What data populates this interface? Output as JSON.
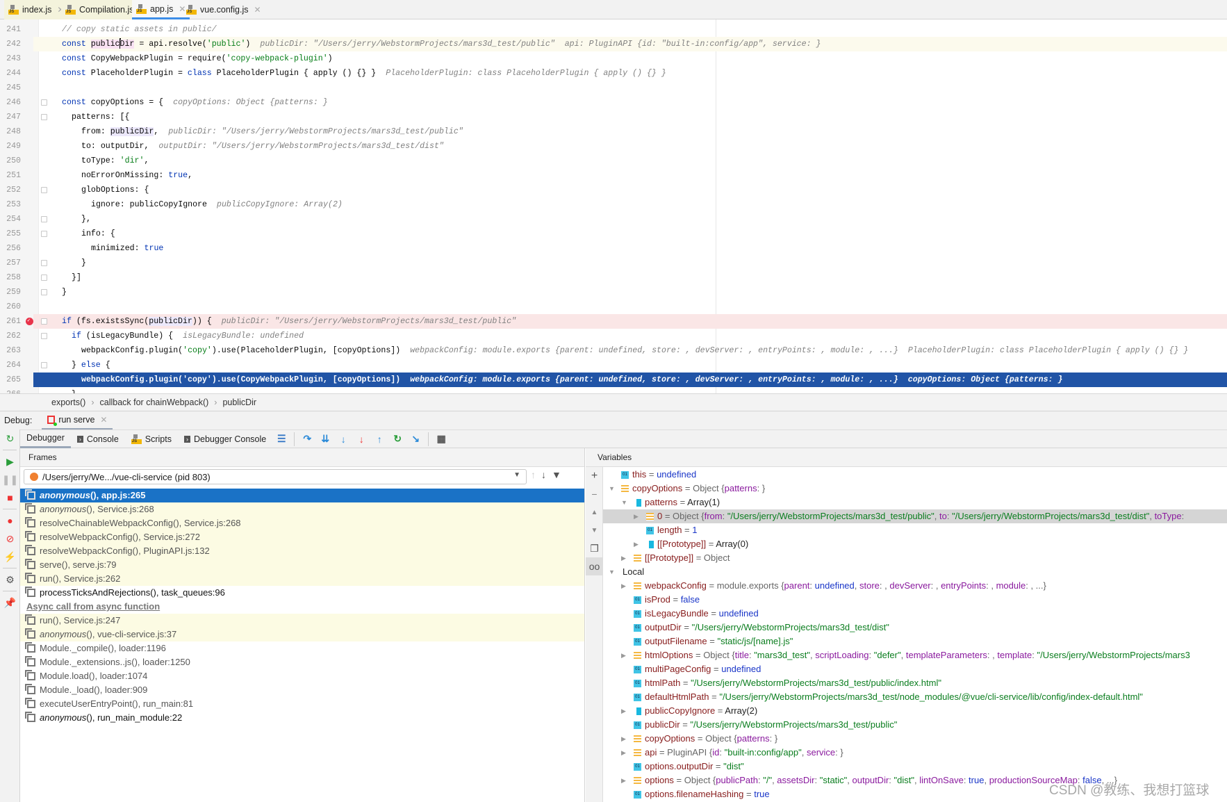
{
  "tabs": [
    {
      "label": "index.js",
      "style": "yellow"
    },
    {
      "label": "Compilation.js",
      "style": "yellow"
    },
    {
      "label": "app.js",
      "style": "sel"
    },
    {
      "label": "vue.config.js",
      "style": ""
    }
  ],
  "editor": {
    "lines": [
      {
        "n": "241",
        "indent": 0,
        "tokens": [
          [
            "// copy static assets in public/",
            "cm"
          ]
        ]
      },
      {
        "n": "242",
        "indent": 0,
        "state": "cur",
        "tokens": [
          [
            "const ",
            "kw"
          ],
          [
            "public",
            "pl hlp"
          ],
          [
            "|caret",
            ""
          ],
          [
            "Dir",
            "pl hlp"
          ],
          [
            " = api.resolve(",
            "pl"
          ],
          [
            "'public'",
            "str"
          ],
          [
            ")",
            "pl"
          ]
        ],
        "hint": "publicDir: \"/Users/jerry/WebstormProjects/mars3d_test/public\"  api: PluginAPI {id: \"built-in:config/app\", service: }"
      },
      {
        "n": "243",
        "indent": 0,
        "tokens": [
          [
            "const ",
            "kw"
          ],
          [
            "CopyWebpackPlugin = require(",
            "pl"
          ],
          [
            "'copy-webpack-plugin'",
            "str"
          ],
          [
            ")",
            "pl"
          ]
        ]
      },
      {
        "n": "244",
        "indent": 0,
        "tokens": [
          [
            "const ",
            "kw"
          ],
          [
            "PlaceholderPlugin = ",
            "pl"
          ],
          [
            "class ",
            "kw"
          ],
          [
            "PlaceholderPlugin { apply () {} }",
            "pl"
          ]
        ],
        "hint": "PlaceholderPlugin: class PlaceholderPlugin { apply () {} }"
      },
      {
        "n": "245",
        "indent": 0,
        "tokens": []
      },
      {
        "n": "246",
        "indent": 0,
        "fold": true,
        "tokens": [
          [
            "const ",
            "kw"
          ],
          [
            "copyOptions = {",
            "pl"
          ]
        ],
        "hint": "copyOptions: Object {patterns: }"
      },
      {
        "n": "247",
        "indent": 1,
        "fold": true,
        "tokens": [
          [
            "patterns: [{",
            "pl"
          ]
        ]
      },
      {
        "n": "248",
        "indent": 2,
        "tokens": [
          [
            "from: ",
            "pl"
          ],
          [
            "publicDir",
            "pl hlv"
          ],
          [
            ",",
            "pl"
          ]
        ],
        "hint": "publicDir: \"/Users/jerry/WebstormProjects/mars3d_test/public\""
      },
      {
        "n": "249",
        "indent": 2,
        "tokens": [
          [
            "to: outputDir,",
            "pl"
          ]
        ],
        "hint": "outputDir: \"/Users/jerry/WebstormProjects/mars3d_test/dist\""
      },
      {
        "n": "250",
        "indent": 2,
        "tokens": [
          [
            "toType: ",
            "pl"
          ],
          [
            "'dir'",
            "str"
          ],
          [
            ",",
            "pl"
          ]
        ]
      },
      {
        "n": "251",
        "indent": 2,
        "tokens": [
          [
            "noErrorOnMissing: ",
            "pl"
          ],
          [
            "true",
            "kw"
          ],
          [
            ",",
            "pl"
          ]
        ]
      },
      {
        "n": "252",
        "indent": 2,
        "fold": true,
        "tokens": [
          [
            "globOptions: {",
            "pl"
          ]
        ]
      },
      {
        "n": "253",
        "indent": 3,
        "tokens": [
          [
            "ignore: publicCopyIgnore",
            "pl"
          ]
        ],
        "hint": "publicCopyIgnore: Array(2)"
      },
      {
        "n": "254",
        "indent": 2,
        "fold": true,
        "tokens": [
          [
            "},",
            "pl"
          ]
        ]
      },
      {
        "n": "255",
        "indent": 2,
        "fold": true,
        "tokens": [
          [
            "info: {",
            "pl"
          ]
        ]
      },
      {
        "n": "256",
        "indent": 3,
        "tokens": [
          [
            "minimized: ",
            "pl"
          ],
          [
            "true",
            "kw"
          ]
        ]
      },
      {
        "n": "257",
        "indent": 2,
        "fold": true,
        "tokens": [
          [
            "}",
            "pl"
          ]
        ]
      },
      {
        "n": "258",
        "indent": 1,
        "fold": true,
        "tokens": [
          [
            "}]",
            "pl"
          ]
        ]
      },
      {
        "n": "259",
        "indent": 0,
        "fold": true,
        "tokens": [
          [
            "}",
            "pl"
          ]
        ]
      },
      {
        "n": "260",
        "indent": 0,
        "tokens": []
      },
      {
        "n": "261",
        "indent": 0,
        "state": "brk",
        "breakpoint": true,
        "fold": true,
        "tokens": [
          [
            "if ",
            "kw"
          ],
          [
            "(fs.existsSync(",
            "pl"
          ],
          [
            "publicDir",
            "pl hlv"
          ],
          [
            ")) {",
            "pl"
          ]
        ],
        "hint": "publicDir: \"/Users/jerry/WebstormProjects/mars3d_test/public\""
      },
      {
        "n": "262",
        "indent": 1,
        "fold": true,
        "tokens": [
          [
            "if ",
            "kw"
          ],
          [
            "(isLegacyBundle) {",
            "pl"
          ]
        ],
        "hint": "isLegacyBundle: undefined"
      },
      {
        "n": "263",
        "indent": 2,
        "tokens": [
          [
            "webpackConfig.plugin(",
            "pl"
          ],
          [
            "'copy'",
            "str"
          ],
          [
            ").use(PlaceholderPlugin, [copyOptions])",
            "pl"
          ]
        ],
        "hint": "webpackConfig: module.exports {parent: undefined, store: , devServer: , entryPoints: , module: , ...}  PlaceholderPlugin: class PlaceholderPlugin { apply () {} }"
      },
      {
        "n": "264",
        "indent": 1,
        "fold": true,
        "tokens": [
          [
            "} ",
            "pl"
          ],
          [
            "else ",
            "kw"
          ],
          [
            "{",
            "pl"
          ]
        ]
      },
      {
        "n": "265",
        "indent": 2,
        "state": "exec",
        "tokens": [
          [
            "webpackConfig.plugin('copy').use(CopyWebpackPlugin, [copyOptions])",
            "pl"
          ]
        ],
        "hint": "webpackConfig: module.exports {parent: undefined, store: , devServer: , entryPoints: , module: , ...}  copyOptions: Object {patterns: }"
      },
      {
        "n": "266",
        "indent": 1,
        "tokens": [
          [
            "}",
            "pl"
          ]
        ]
      }
    ]
  },
  "breadcrumb": [
    "exports()",
    "callback for chainWebpack()",
    "publicDir"
  ],
  "debug": {
    "label": "Debug:",
    "run_tab": "run serve",
    "tabs": [
      "Debugger",
      "Console",
      "Scripts",
      "Debugger Console"
    ],
    "frames_title": "Frames",
    "variables_title": "Variables",
    "thread": "/Users/jerry/We.../vue-cli-service (pid 803)"
  },
  "frames": [
    {
      "fn": "anonymous",
      "rest": "(), app.js:265",
      "style": "sel",
      "italic": true
    },
    {
      "fn": "anonymous",
      "rest": "(), Service.js:268",
      "style": "lib",
      "italic": true
    },
    {
      "fn": "resolveChainableWebpackConfig",
      "rest": "(), Service.js:268",
      "style": "lib"
    },
    {
      "fn": "resolveWebpackConfig",
      "rest": "(), Service.js:272",
      "style": "lib"
    },
    {
      "fn": "resolveWebpackConfig",
      "rest": "(), PluginAPI.js:132",
      "style": "lib"
    },
    {
      "fn": "serve",
      "rest": "(), serve.js:79",
      "style": "lib"
    },
    {
      "fn": "run",
      "rest": "(), Service.js:262",
      "style": "lib"
    },
    {
      "fn": "processTicksAndRejections",
      "rest": "(), task_queues:96",
      "style": "dark"
    },
    {
      "separator": "Async call from async function"
    },
    {
      "fn": "run",
      "rest": "(), Service.js:247",
      "style": "lib"
    },
    {
      "fn": "anonymous",
      "rest": "(), vue-cli-service.js:37",
      "style": "lib",
      "italic": true
    },
    {
      "fn": "Module._compile",
      "rest": "(), loader:1196",
      "style": ""
    },
    {
      "fn": "Module._extensions..js",
      "rest": "(), loader:1250",
      "style": ""
    },
    {
      "fn": "Module.load",
      "rest": "(), loader:1074",
      "style": ""
    },
    {
      "fn": "Module._load",
      "rest": "(), loader:909",
      "style": ""
    },
    {
      "fn": "executeUserEntryPoint",
      "rest": "(), run_main:81",
      "style": ""
    },
    {
      "fn": "anonymous",
      "rest": "(), run_main_module:22",
      "style": "dark",
      "italic": true
    }
  ],
  "variables": [
    {
      "lvl": 0,
      "arrow": "",
      "icon": "prim",
      "parts": [
        [
          "this",
          "vn"
        ],
        [
          " = ",
          "vg"
        ],
        [
          "undefined",
          "vb"
        ]
      ]
    },
    {
      "lvl": 0,
      "arrow": "down",
      "icon": "obj",
      "parts": [
        [
          "copyOptions",
          "vn"
        ],
        [
          " = Object {",
          "vg"
        ],
        [
          "patterns",
          "vk"
        ],
        [
          ": }",
          "vg"
        ]
      ]
    },
    {
      "lvl": 1,
      "arrow": "down",
      "icon": "arr",
      "parts": [
        [
          "patterns",
          "vn"
        ],
        [
          " = ",
          "vg"
        ],
        [
          "Array(1)",
          "vp"
        ]
      ]
    },
    {
      "lvl": 2,
      "arrow": "right",
      "icon": "obj",
      "sel": true,
      "parts": [
        [
          "0",
          "vn"
        ],
        [
          " = Object {",
          "vg"
        ],
        [
          "from",
          "vk"
        ],
        [
          ": ",
          "vg"
        ],
        [
          "\"/Users/jerry/WebstormProjects/mars3d_test/public\"",
          "vs"
        ],
        [
          ", ",
          "vg"
        ],
        [
          "to",
          "vk"
        ],
        [
          ": ",
          "vg"
        ],
        [
          "\"/Users/jerry/WebstormProjects/mars3d_test/dist\"",
          "vs"
        ],
        [
          ", ",
          "vg"
        ],
        [
          "toType",
          "vk"
        ],
        [
          ":",
          "vg"
        ]
      ]
    },
    {
      "lvl": 2,
      "arrow": "",
      "icon": "prim",
      "parts": [
        [
          "length",
          "vn"
        ],
        [
          " = ",
          "vg"
        ],
        [
          "1",
          "vb"
        ]
      ]
    },
    {
      "lvl": 2,
      "arrow": "right",
      "icon": "arr",
      "parts": [
        [
          "[[Prototype]]",
          "vn"
        ],
        [
          " = ",
          "vg"
        ],
        [
          "Array(0)",
          "vp"
        ]
      ]
    },
    {
      "lvl": 1,
      "arrow": "right",
      "icon": "obj",
      "parts": [
        [
          "[[Prototype]]",
          "vn"
        ],
        [
          " = Object",
          "vg"
        ]
      ]
    },
    {
      "lvl": 0,
      "arrow": "down",
      "icon": "",
      "parts": [
        [
          "Local",
          "vp"
        ]
      ]
    },
    {
      "lvl": 1,
      "arrow": "right",
      "icon": "obj",
      "parts": [
        [
          "webpackConfig",
          "vn"
        ],
        [
          " = module.exports {",
          "vg"
        ],
        [
          "parent",
          "vk"
        ],
        [
          ": ",
          "vg"
        ],
        [
          "undefined",
          "vb"
        ],
        [
          ", ",
          "vg"
        ],
        [
          "store",
          "vk"
        ],
        [
          ": , ",
          "vg"
        ],
        [
          "devServer",
          "vk"
        ],
        [
          ": , ",
          "vg"
        ],
        [
          "entryPoints",
          "vk"
        ],
        [
          ": , ",
          "vg"
        ],
        [
          "module",
          "vk"
        ],
        [
          ": , ...}",
          "vg"
        ]
      ]
    },
    {
      "lvl": 1,
      "arrow": "",
      "icon": "prim",
      "parts": [
        [
          "isProd",
          "vn"
        ],
        [
          " = ",
          "vg"
        ],
        [
          "false",
          "vb"
        ]
      ]
    },
    {
      "lvl": 1,
      "arrow": "",
      "icon": "prim",
      "parts": [
        [
          "isLegacyBundle",
          "vn"
        ],
        [
          " = ",
          "vg"
        ],
        [
          "undefined",
          "vb"
        ]
      ]
    },
    {
      "lvl": 1,
      "arrow": "",
      "icon": "prim",
      "parts": [
        [
          "outputDir",
          "vn"
        ],
        [
          " = ",
          "vg"
        ],
        [
          "\"/Users/jerry/WebstormProjects/mars3d_test/dist\"",
          "vs"
        ]
      ]
    },
    {
      "lvl": 1,
      "arrow": "",
      "icon": "prim",
      "parts": [
        [
          "outputFilename",
          "vn"
        ],
        [
          " = ",
          "vg"
        ],
        [
          "\"static/js/[name].js\"",
          "vs"
        ]
      ]
    },
    {
      "lvl": 1,
      "arrow": "right",
      "icon": "obj",
      "parts": [
        [
          "htmlOptions",
          "vn"
        ],
        [
          " = Object {",
          "vg"
        ],
        [
          "title",
          "vk"
        ],
        [
          ": ",
          "vg"
        ],
        [
          "\"mars3d_test\"",
          "vs"
        ],
        [
          ", ",
          "vg"
        ],
        [
          "scriptLoading",
          "vk"
        ],
        [
          ": ",
          "vg"
        ],
        [
          "\"defer\"",
          "vs"
        ],
        [
          ", ",
          "vg"
        ],
        [
          "templateParameters",
          "vk"
        ],
        [
          ": , ",
          "vg"
        ],
        [
          "template",
          "vk"
        ],
        [
          ": ",
          "vg"
        ],
        [
          "\"/Users/jerry/WebstormProjects/mars3",
          "vs"
        ]
      ]
    },
    {
      "lvl": 1,
      "arrow": "",
      "icon": "prim",
      "parts": [
        [
          "multiPageConfig",
          "vn"
        ],
        [
          " = ",
          "vg"
        ],
        [
          "undefined",
          "vb"
        ]
      ]
    },
    {
      "lvl": 1,
      "arrow": "",
      "icon": "prim",
      "parts": [
        [
          "htmlPath",
          "vn"
        ],
        [
          " = ",
          "vg"
        ],
        [
          "\"/Users/jerry/WebstormProjects/mars3d_test/public/index.html\"",
          "vs"
        ]
      ]
    },
    {
      "lvl": 1,
      "arrow": "",
      "icon": "prim",
      "parts": [
        [
          "defaultHtmlPath",
          "vn"
        ],
        [
          " = ",
          "vg"
        ],
        [
          "\"/Users/jerry/WebstormProjects/mars3d_test/node_modules/@vue/cli-service/lib/config/index-default.html\"",
          "vs"
        ]
      ]
    },
    {
      "lvl": 1,
      "arrow": "right",
      "icon": "arr",
      "parts": [
        [
          "publicCopyIgnore",
          "vn"
        ],
        [
          " = ",
          "vg"
        ],
        [
          "Array(2)",
          "vp"
        ]
      ]
    },
    {
      "lvl": 1,
      "arrow": "",
      "icon": "prim",
      "parts": [
        [
          "publicDir",
          "vn"
        ],
        [
          " = ",
          "vg"
        ],
        [
          "\"/Users/jerry/WebstormProjects/mars3d_test/public\"",
          "vs"
        ]
      ]
    },
    {
      "lvl": 1,
      "arrow": "right",
      "icon": "obj",
      "parts": [
        [
          "copyOptions",
          "vn"
        ],
        [
          " = Object {",
          "vg"
        ],
        [
          "patterns",
          "vk"
        ],
        [
          ": }",
          "vg"
        ]
      ]
    },
    {
      "lvl": 1,
      "arrow": "right",
      "icon": "obj",
      "parts": [
        [
          "api",
          "vn"
        ],
        [
          " = PluginAPI {",
          "vg"
        ],
        [
          "id",
          "vk"
        ],
        [
          ": ",
          "vg"
        ],
        [
          "\"built-in:config/app\"",
          "vs"
        ],
        [
          ", ",
          "vg"
        ],
        [
          "service",
          "vk"
        ],
        [
          ": }",
          "vg"
        ]
      ]
    },
    {
      "lvl": 1,
      "arrow": "",
      "icon": "prim",
      "parts": [
        [
          "options.outputDir",
          "vn"
        ],
        [
          " = ",
          "vg"
        ],
        [
          "\"dist\"",
          "vs"
        ]
      ]
    },
    {
      "lvl": 1,
      "arrow": "right",
      "icon": "obj",
      "parts": [
        [
          "options",
          "vn"
        ],
        [
          " = Object {",
          "vg"
        ],
        [
          "publicPath",
          "vk"
        ],
        [
          ": ",
          "vg"
        ],
        [
          "\"/\"",
          "vs"
        ],
        [
          ", ",
          "vg"
        ],
        [
          "assetsDir",
          "vk"
        ],
        [
          ": ",
          "vg"
        ],
        [
          "\"static\"",
          "vs"
        ],
        [
          ", ",
          "vg"
        ],
        [
          "outputDir",
          "vk"
        ],
        [
          ": ",
          "vg"
        ],
        [
          "\"dist\"",
          "vs"
        ],
        [
          ", ",
          "vg"
        ],
        [
          "lintOnSave",
          "vk"
        ],
        [
          ": ",
          "vg"
        ],
        [
          "true",
          "vb"
        ],
        [
          ", ",
          "vg"
        ],
        [
          "productionSourceMap",
          "vk"
        ],
        [
          ": ",
          "vg"
        ],
        [
          "false",
          "vb"
        ],
        [
          ", ...}",
          "vg"
        ]
      ]
    },
    {
      "lvl": 1,
      "arrow": "",
      "icon": "prim",
      "parts": [
        [
          "options.filenameHashing",
          "vn"
        ],
        [
          " = ",
          "vg"
        ],
        [
          "true",
          "vb"
        ]
      ]
    }
  ],
  "watermark": "CSDN @教练、我想打篮球",
  "colors": {
    "accent": "#1a72c6",
    "exec_line": "#2154a6",
    "breakpoint": "#e8334a"
  }
}
